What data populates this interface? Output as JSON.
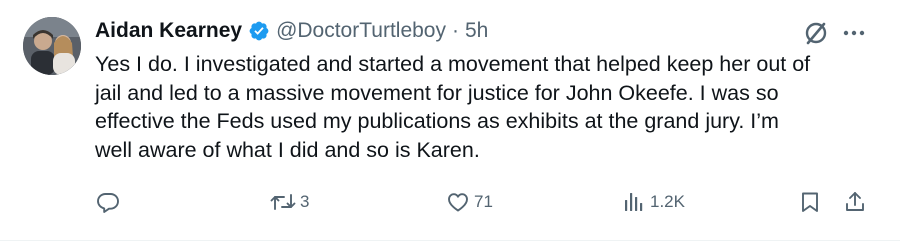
{
  "tweet": {
    "author_name": "Aidan Kearney",
    "handle": "@DoctorTurtleboy",
    "separator": "·",
    "time": "5h",
    "lines": [
      "Yes I do. I investigated and started a movement that helped keep her out of",
      "jail and led to a massive movement for justice for John Okeefe. I was so",
      "effective the Feds used my publications as exhibits at the grand jury. I’m",
      "well aware of what I did and so is Karen."
    ]
  },
  "actions": {
    "reply_count": "",
    "repost_count": "3",
    "like_count": "71",
    "views_count": "1.2K"
  },
  "colors": {
    "text": "#0f1419",
    "secondary": "#536471",
    "verified": "#1d9bf0",
    "divider": "#eff3f4"
  },
  "icons": [
    "grok-icon",
    "more-icon",
    "verified-badge-icon",
    "reply-icon",
    "repost-icon",
    "like-icon",
    "views-icon",
    "bookmark-icon",
    "share-icon"
  ]
}
